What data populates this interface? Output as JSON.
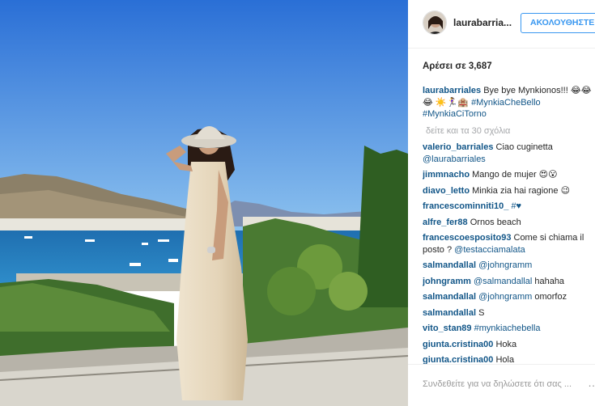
{
  "post": {
    "username": "laurabarria...",
    "follow_label": "ΑΚΟΛΟΥΘΗΣΤΕ",
    "likes_text": "Αρέσει σε 3,687",
    "caption": {
      "user": "laurabarriales",
      "text_line1": "Bye bye Mynkionos!!!",
      "emojis": "😂😂😂 ☀️🏃‍♀️🏨",
      "tag1": "#MynkiaCheBello",
      "tag2": "#MynkiaCiTorno"
    },
    "load_more": "δείτε και τα 30 σχόλια"
  },
  "comments": [
    {
      "user": "valerio_barriales",
      "text": "Ciao cuginetta",
      "tag": "@laurabarriales"
    },
    {
      "user": "jimmnacho",
      "text": "Mango de mujer 😍😮",
      "tag": ""
    },
    {
      "user": "diavo_letto",
      "text": "Minkia zia hai ragione 😉",
      "tag": ""
    },
    {
      "user": "francescominniti10_",
      "text": "",
      "tag": "#♥"
    },
    {
      "user": "alfre_fer88",
      "text": "Ornos beach",
      "tag": ""
    },
    {
      "user": "francescoesposito93",
      "text": "Come si chiama il posto ?",
      "tag": "@testacciamalata"
    },
    {
      "user": "salmandallal",
      "text": "",
      "tag": "@johngramm"
    },
    {
      "user": "johngramm",
      "text": "hahaha",
      "tag": "@salmandallal"
    },
    {
      "user": "salmandallal",
      "text": "omorfoz",
      "tag": "@johngramm"
    },
    {
      "user": "salmandallal",
      "text": "S",
      "tag": ""
    },
    {
      "user": "vito_stan89",
      "text": "",
      "tag": "#mynkiachebella"
    },
    {
      "user": "giunta.cristina00",
      "text": "Hoka",
      "tag": ""
    },
    {
      "user": "giunta.cristina00",
      "text": "Hola",
      "tag": ""
    }
  ],
  "footer": {
    "login_prompt": "Συνδεθείτε για να δηλώσετε ότι σας ...",
    "more_icon": "…"
  }
}
